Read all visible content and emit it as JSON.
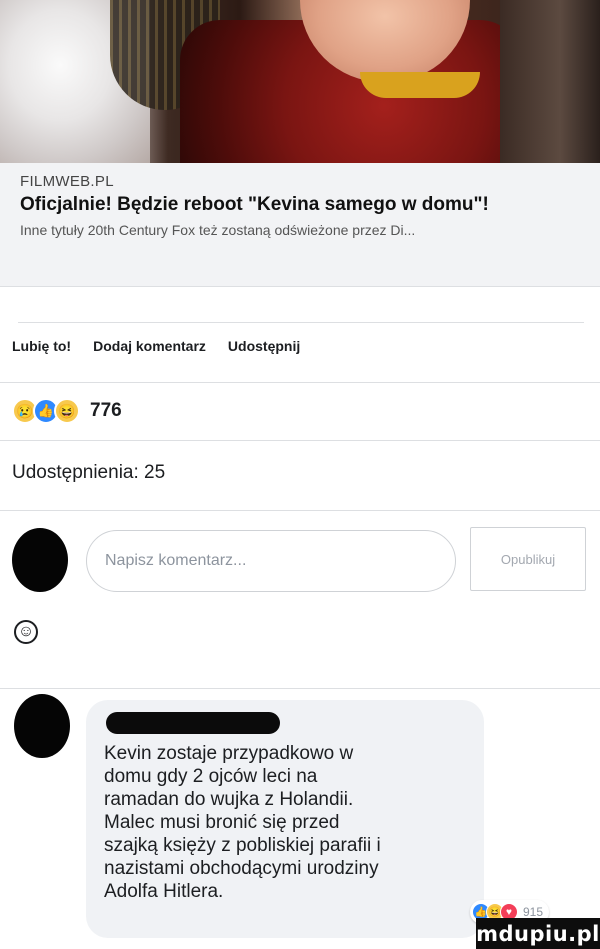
{
  "link_preview": {
    "domain": "FILMWEB.PL",
    "title": "Oficjalnie! Będzie reboot \"Kevina samego w domu\"!",
    "description": "Inne tytuły 20th Century Fox też zostaną odświeżone przez Di..."
  },
  "actions": {
    "like": "Lubię to!",
    "comment": "Dodaj komentarz",
    "share": "Udostępnij"
  },
  "reactions": {
    "icons": [
      "crying-face-icon",
      "thumbs-up-icon",
      "laughing-face-icon"
    ],
    "count": "776"
  },
  "shares": "Udostępnienia: 25",
  "composer": {
    "placeholder": "Napisz komentarz...",
    "publish_label": "Opublikuj"
  },
  "comment": {
    "text": "Kevin zostaje przypadkowo w\ndomu gdy 2 ojców leci na\nramadan do wujka z Holandii.\nMalec musi bronić się przed\nszajką księży z pobliskiej parafii i\nnazistami obchodącymi urodziny\nAdolfa Hitlera.",
    "reaction_icons": [
      "thumbs-up-icon",
      "laughing-face-icon",
      "heart-icon"
    ],
    "reaction_count": "915"
  },
  "watermark": "mdupiu.pl",
  "colors": {
    "link_background": "#f2f3f5",
    "bubble_background": "#f0f2f5",
    "like_blue": "#2e89ff",
    "reaction_yellow": "#f7c94d"
  }
}
